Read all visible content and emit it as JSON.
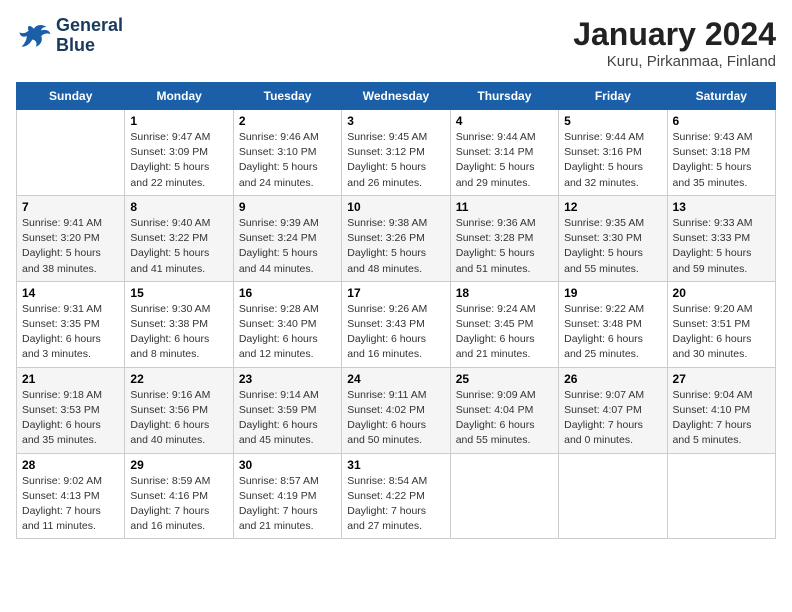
{
  "logo": {
    "line1": "General",
    "line2": "Blue"
  },
  "title": "January 2024",
  "subtitle": "Kuru, Pirkanmaa, Finland",
  "weekdays": [
    "Sunday",
    "Monday",
    "Tuesday",
    "Wednesday",
    "Thursday",
    "Friday",
    "Saturday"
  ],
  "weeks": [
    [
      {
        "day": "",
        "sunrise": "",
        "sunset": "",
        "daylight": ""
      },
      {
        "day": "1",
        "sunrise": "Sunrise: 9:47 AM",
        "sunset": "Sunset: 3:09 PM",
        "daylight": "Daylight: 5 hours and 22 minutes."
      },
      {
        "day": "2",
        "sunrise": "Sunrise: 9:46 AM",
        "sunset": "Sunset: 3:10 PM",
        "daylight": "Daylight: 5 hours and 24 minutes."
      },
      {
        "day": "3",
        "sunrise": "Sunrise: 9:45 AM",
        "sunset": "Sunset: 3:12 PM",
        "daylight": "Daylight: 5 hours and 26 minutes."
      },
      {
        "day": "4",
        "sunrise": "Sunrise: 9:44 AM",
        "sunset": "Sunset: 3:14 PM",
        "daylight": "Daylight: 5 hours and 29 minutes."
      },
      {
        "day": "5",
        "sunrise": "Sunrise: 9:44 AM",
        "sunset": "Sunset: 3:16 PM",
        "daylight": "Daylight: 5 hours and 32 minutes."
      },
      {
        "day": "6",
        "sunrise": "Sunrise: 9:43 AM",
        "sunset": "Sunset: 3:18 PM",
        "daylight": "Daylight: 5 hours and 35 minutes."
      }
    ],
    [
      {
        "day": "7",
        "sunrise": "Sunrise: 9:41 AM",
        "sunset": "Sunset: 3:20 PM",
        "daylight": "Daylight: 5 hours and 38 minutes."
      },
      {
        "day": "8",
        "sunrise": "Sunrise: 9:40 AM",
        "sunset": "Sunset: 3:22 PM",
        "daylight": "Daylight: 5 hours and 41 minutes."
      },
      {
        "day": "9",
        "sunrise": "Sunrise: 9:39 AM",
        "sunset": "Sunset: 3:24 PM",
        "daylight": "Daylight: 5 hours and 44 minutes."
      },
      {
        "day": "10",
        "sunrise": "Sunrise: 9:38 AM",
        "sunset": "Sunset: 3:26 PM",
        "daylight": "Daylight: 5 hours and 48 minutes."
      },
      {
        "day": "11",
        "sunrise": "Sunrise: 9:36 AM",
        "sunset": "Sunset: 3:28 PM",
        "daylight": "Daylight: 5 hours and 51 minutes."
      },
      {
        "day": "12",
        "sunrise": "Sunrise: 9:35 AM",
        "sunset": "Sunset: 3:30 PM",
        "daylight": "Daylight: 5 hours and 55 minutes."
      },
      {
        "day": "13",
        "sunrise": "Sunrise: 9:33 AM",
        "sunset": "Sunset: 3:33 PM",
        "daylight": "Daylight: 5 hours and 59 minutes."
      }
    ],
    [
      {
        "day": "14",
        "sunrise": "Sunrise: 9:31 AM",
        "sunset": "Sunset: 3:35 PM",
        "daylight": "Daylight: 6 hours and 3 minutes."
      },
      {
        "day": "15",
        "sunrise": "Sunrise: 9:30 AM",
        "sunset": "Sunset: 3:38 PM",
        "daylight": "Daylight: 6 hours and 8 minutes."
      },
      {
        "day": "16",
        "sunrise": "Sunrise: 9:28 AM",
        "sunset": "Sunset: 3:40 PM",
        "daylight": "Daylight: 6 hours and 12 minutes."
      },
      {
        "day": "17",
        "sunrise": "Sunrise: 9:26 AM",
        "sunset": "Sunset: 3:43 PM",
        "daylight": "Daylight: 6 hours and 16 minutes."
      },
      {
        "day": "18",
        "sunrise": "Sunrise: 9:24 AM",
        "sunset": "Sunset: 3:45 PM",
        "daylight": "Daylight: 6 hours and 21 minutes."
      },
      {
        "day": "19",
        "sunrise": "Sunrise: 9:22 AM",
        "sunset": "Sunset: 3:48 PM",
        "daylight": "Daylight: 6 hours and 25 minutes."
      },
      {
        "day": "20",
        "sunrise": "Sunrise: 9:20 AM",
        "sunset": "Sunset: 3:51 PM",
        "daylight": "Daylight: 6 hours and 30 minutes."
      }
    ],
    [
      {
        "day": "21",
        "sunrise": "Sunrise: 9:18 AM",
        "sunset": "Sunset: 3:53 PM",
        "daylight": "Daylight: 6 hours and 35 minutes."
      },
      {
        "day": "22",
        "sunrise": "Sunrise: 9:16 AM",
        "sunset": "Sunset: 3:56 PM",
        "daylight": "Daylight: 6 hours and 40 minutes."
      },
      {
        "day": "23",
        "sunrise": "Sunrise: 9:14 AM",
        "sunset": "Sunset: 3:59 PM",
        "daylight": "Daylight: 6 hours and 45 minutes."
      },
      {
        "day": "24",
        "sunrise": "Sunrise: 9:11 AM",
        "sunset": "Sunset: 4:02 PM",
        "daylight": "Daylight: 6 hours and 50 minutes."
      },
      {
        "day": "25",
        "sunrise": "Sunrise: 9:09 AM",
        "sunset": "Sunset: 4:04 PM",
        "daylight": "Daylight: 6 hours and 55 minutes."
      },
      {
        "day": "26",
        "sunrise": "Sunrise: 9:07 AM",
        "sunset": "Sunset: 4:07 PM",
        "daylight": "Daylight: 7 hours and 0 minutes."
      },
      {
        "day": "27",
        "sunrise": "Sunrise: 9:04 AM",
        "sunset": "Sunset: 4:10 PM",
        "daylight": "Daylight: 7 hours and 5 minutes."
      }
    ],
    [
      {
        "day": "28",
        "sunrise": "Sunrise: 9:02 AM",
        "sunset": "Sunset: 4:13 PM",
        "daylight": "Daylight: 7 hours and 11 minutes."
      },
      {
        "day": "29",
        "sunrise": "Sunrise: 8:59 AM",
        "sunset": "Sunset: 4:16 PM",
        "daylight": "Daylight: 7 hours and 16 minutes."
      },
      {
        "day": "30",
        "sunrise": "Sunrise: 8:57 AM",
        "sunset": "Sunset: 4:19 PM",
        "daylight": "Daylight: 7 hours and 21 minutes."
      },
      {
        "day": "31",
        "sunrise": "Sunrise: 8:54 AM",
        "sunset": "Sunset: 4:22 PM",
        "daylight": "Daylight: 7 hours and 27 minutes."
      },
      {
        "day": "",
        "sunrise": "",
        "sunset": "",
        "daylight": ""
      },
      {
        "day": "",
        "sunrise": "",
        "sunset": "",
        "daylight": ""
      },
      {
        "day": "",
        "sunrise": "",
        "sunset": "",
        "daylight": ""
      }
    ]
  ]
}
